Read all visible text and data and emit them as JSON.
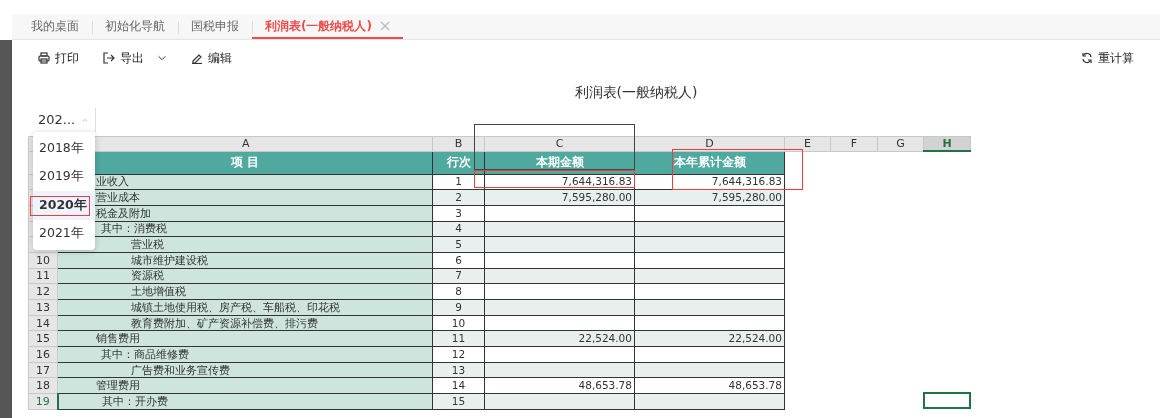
{
  "tabs": [
    {
      "label": "我的桌面",
      "selected": false,
      "closable": false
    },
    {
      "label": "初始化导航",
      "selected": false,
      "closable": false
    },
    {
      "label": "国税申报",
      "selected": false,
      "closable": false
    },
    {
      "label": "利润表(一般纳税人)",
      "selected": true,
      "closable": true
    }
  ],
  "toolbar": {
    "left": [
      {
        "label": "打印",
        "dropdown": false
      },
      {
        "label": "导出",
        "dropdown": true
      },
      {
        "label": "编辑",
        "dropdown": false
      }
    ],
    "right": [
      {
        "label": "重计算",
        "dropdown": false
      }
    ]
  },
  "report_title": "利润表(一般纳税人)",
  "year_select": {
    "value": "202...",
    "expanded": true,
    "options": [
      {
        "label": "2018年",
        "selected": false
      },
      {
        "label": "2019年",
        "selected": false
      },
      {
        "label": "2020年",
        "selected": true
      },
      {
        "label": "2021年",
        "selected": false
      }
    ]
  },
  "sheet": {
    "column_letters": [
      {
        "label": "A",
        "active": false
      },
      {
        "label": "B",
        "active": false
      },
      {
        "label": "C",
        "active": false
      },
      {
        "label": "D",
        "active": false
      },
      {
        "label": "E",
        "active": false
      },
      {
        "label": "F",
        "active": false
      },
      {
        "label": "G",
        "active": false
      },
      {
        "label": "H",
        "active": true
      }
    ],
    "header": [
      "项  目",
      "行次",
      "本期金额",
      "本年累计金额"
    ],
    "rows": [
      {
        "kind": "main",
        "label": "业收入",
        "line": "1",
        "current": "7,644,316.83",
        "ytd": "7,644,316.83",
        "shaded": false
      },
      {
        "kind": "main",
        "label": "营业成本",
        "line": "2",
        "current": "7,595,280.00",
        "ytd": "7,595,280.00",
        "shaded": true
      },
      {
        "kind": "main",
        "label": "税金及附加",
        "line": "3",
        "shaded": false
      },
      {
        "kind": "sub",
        "label": "其中：消费税",
        "line": "4",
        "shaded": true
      },
      {
        "kind": "item",
        "label": "营业税",
        "line": "5",
        "shaded": true
      },
      {
        "kind": "item",
        "row_number": "10",
        "label": "城市维护建设税",
        "line": "6",
        "shaded": false,
        "active": false
      },
      {
        "kind": "item",
        "row_number": "11",
        "label": "资源税",
        "line": "7",
        "shaded": true,
        "active": false
      },
      {
        "kind": "item",
        "row_number": "12",
        "label": "土地增值税",
        "line": "8",
        "shaded": false,
        "active": false
      },
      {
        "kind": "item",
        "row_number": "13",
        "label": "城镇土地使用税、房产税、车船税、印花税",
        "line": "9",
        "shaded": true,
        "active": false
      },
      {
        "kind": "item",
        "row_number": "14",
        "label": "教育费附加、矿产资源补偿费、排污费",
        "line": "10",
        "shaded": false,
        "active": false
      },
      {
        "kind": "main",
        "row_number": "15",
        "label": "销售费用",
        "line": "11",
        "current": "22,524.00",
        "ytd": "22,524.00",
        "shaded": true,
        "active": false
      },
      {
        "kind": "sub",
        "row_number": "16",
        "label": "其中：商品维修费",
        "line": "12",
        "shaded": false,
        "active": false
      },
      {
        "kind": "item",
        "row_number": "17",
        "label": "广告费和业务宣传费",
        "line": "13",
        "shaded": true,
        "active": false
      },
      {
        "kind": "main",
        "row_number": "18",
        "label": "管理费用",
        "line": "14",
        "current": "48,653.78",
        "ytd": "48,653.78",
        "shaded": false,
        "active": false
      },
      {
        "kind": "sub",
        "row_number": "19",
        "label": "其中：开办费",
        "line": "15",
        "shaded": true,
        "active": true
      }
    ]
  }
}
